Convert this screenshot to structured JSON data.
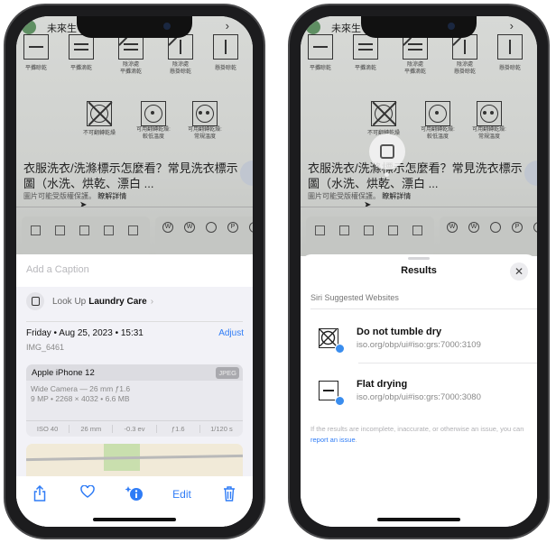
{
  "photo": {
    "header": "未來生",
    "row1": [
      "平攤晾乾",
      "平攤滴乾",
      "陰涼處\n平攤滴乾",
      "陰涼處\n懸掛晾乾",
      "懸掛晾乾"
    ],
    "row2": [
      "不可翻轉乾燥",
      "可用翻轉乾燥:\n較低溫度",
      "可用翻轉乾燥:\n常規溫度"
    ],
    "title": "衣服洗衣/洗滌標示怎麼看？常見洗衣標示圖（水洗、烘乾、漂白 ...",
    "subtitle": "圖片可能受版權保護。",
    "learn_more": "瞭解詳情"
  },
  "info": {
    "caption_placeholder": "Add a Caption",
    "lookup_prefix": "Look Up",
    "lookup_subject": "Laundry Care",
    "date": "Friday • Aug 25, 2023 • 15:31",
    "adjust": "Adjust",
    "filename": "IMG_6461",
    "device": "Apple iPhone 12",
    "format": "JPEG",
    "lens": "Wide Camera — 26 mm ƒ1.6",
    "specs": "9 MP • 2268 × 4032 • 6.6 MB",
    "exif": [
      "ISO 40",
      "26 mm",
      "-0.3 ev",
      "ƒ1.6",
      "1/120 s"
    ]
  },
  "toolbar": {
    "edit": "Edit",
    "icons": [
      "share-icon",
      "heart-icon",
      "info-sparkle-icon",
      "trash-icon"
    ],
    "accent": "#2f7cf6"
  },
  "results": {
    "title": "Results",
    "section": "Siri Suggested Websites",
    "items": [
      {
        "name": "Do not tumble dry",
        "url": "iso.org/obp/ui#iso:grs:7000:3109"
      },
      {
        "name": "Flat drying",
        "url": "iso.org/obp/ui#iso:grs:7000:3080"
      }
    ],
    "footer": "If the results are incomplete, inaccurate, or otherwise an issue, you can",
    "report_link": "report an issue",
    "footer_end": "."
  }
}
